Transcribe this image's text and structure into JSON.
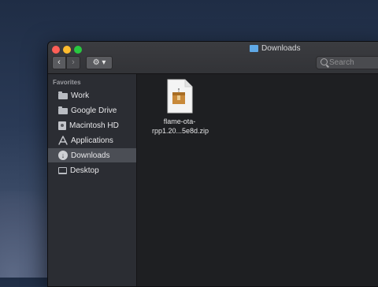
{
  "window": {
    "title": "Downloads",
    "title_icon": "folder-icon"
  },
  "toolbar": {
    "back_label": "‹",
    "forward_label": "›",
    "action_label": "⚙ ▾"
  },
  "search": {
    "placeholder": "Search"
  },
  "sidebar": {
    "heading": "Favorites",
    "items": [
      {
        "label": "Work",
        "icon": "folder-icon"
      },
      {
        "label": "Google Drive",
        "icon": "folder-icon"
      },
      {
        "label": "Macintosh HD",
        "icon": "hard-drive-icon"
      },
      {
        "label": "Applications",
        "icon": "applications-icon"
      },
      {
        "label": "Downloads",
        "icon": "download-icon",
        "selected": true
      },
      {
        "label": "Desktop",
        "icon": "desktop-icon"
      }
    ]
  },
  "files": [
    {
      "name_line1": "flame-ota-",
      "name_line2": "rpp1.20...5e8d.zip",
      "icon": "zip-archive-icon"
    }
  ],
  "colors": {
    "close": "#ff5f57",
    "minimize": "#febc2e",
    "maximize": "#28c840",
    "selection": "#4b4e55",
    "sidebar": "#2b2d33",
    "content": "#1e1f22"
  }
}
